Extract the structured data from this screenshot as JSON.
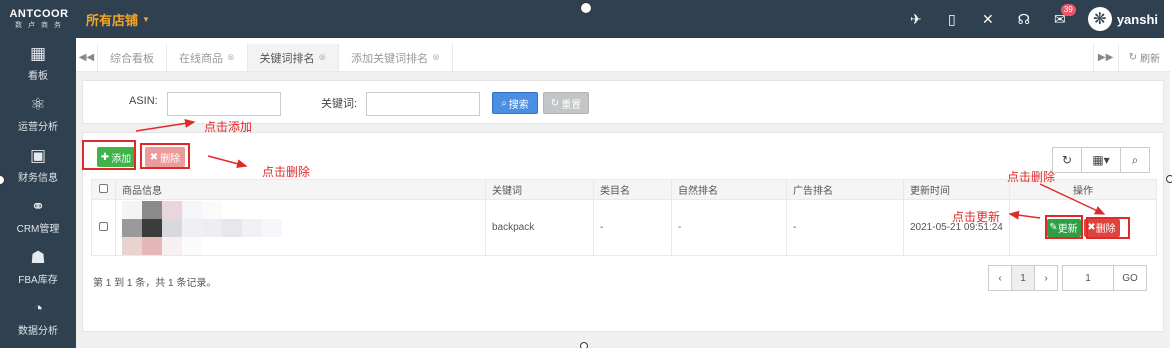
{
  "brand": {
    "name": "ANTCOOR",
    "tagline": "数 卢 商 务"
  },
  "store_selector": {
    "label": "所有店铺"
  },
  "topbar": {
    "message_count": "39",
    "username": "yanshi"
  },
  "sidebar": {
    "items": [
      {
        "icon": "dashboard-icon",
        "label": "看板"
      },
      {
        "icon": "analytics-icon",
        "label": "运营分析"
      },
      {
        "icon": "finance-icon",
        "label": "财务信息"
      },
      {
        "icon": "handshake-icon",
        "label": "CRM管理"
      },
      {
        "icon": "inventory-icon",
        "label": "FBA库存"
      },
      {
        "icon": "chart-pie-icon",
        "label": "数据分析"
      }
    ]
  },
  "tabs": [
    {
      "label": "综合看板",
      "closable": false,
      "active": false
    },
    {
      "label": "在线商品",
      "closable": true,
      "active": false
    },
    {
      "label": "关键词排名",
      "closable": true,
      "active": true
    },
    {
      "label": "添加关键词排名",
      "closable": true,
      "active": false
    }
  ],
  "tab_refresh": "刷新",
  "search": {
    "asin_label": "ASIN:",
    "asin_value": "",
    "keyword_label": "关键词:",
    "keyword_value": "",
    "search_button": "搜索",
    "reset_button": "重置"
  },
  "toolbar": {
    "add_button": "添加",
    "delete_button": "删除"
  },
  "table": {
    "headers": [
      "商品信息",
      "关键词",
      "类目名",
      "自然排名",
      "广告排名",
      "更新时间",
      "操作"
    ],
    "rows": [
      {
        "keyword": "backpack",
        "category": "-",
        "natural_rank": "-",
        "ad_rank": "-",
        "updated": "2021-05-21 09:51:24",
        "update_button": "更新",
        "delete_button": "删除"
      }
    ]
  },
  "pagination": {
    "summary": "第 1 到 1 条，共 1 条记录。",
    "prev": "‹",
    "current": "1",
    "next": "›",
    "jump_value": "1",
    "go": "GO"
  },
  "annotations": {
    "click_add": "点击添加",
    "click_delete": "点击删除",
    "click_delete_row": "点击删除",
    "click_update": "点击更新"
  },
  "colors": {
    "sidebar": "#2f4050",
    "store": "#f5a623",
    "primary": "#4a8fe2",
    "success": "#3fb24a",
    "danger": "#e0423d",
    "annotation": "#e02a2a"
  }
}
